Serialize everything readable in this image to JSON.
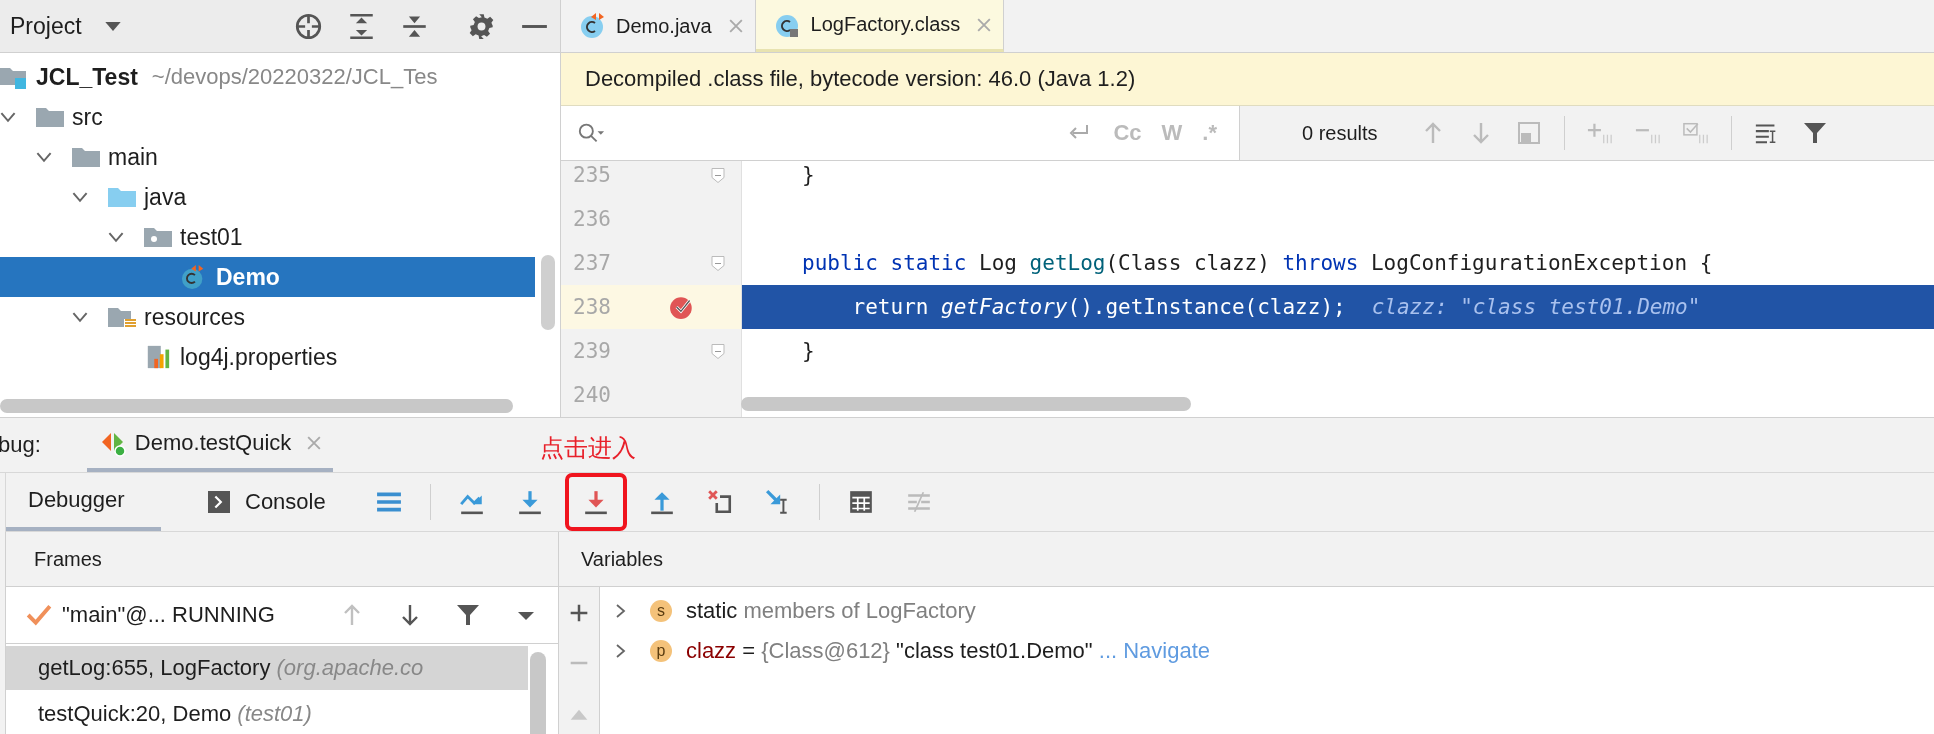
{
  "project_panel": {
    "title": "Project",
    "tools": [
      {
        "kind": "locate"
      },
      {
        "kind": "expand"
      },
      {
        "kind": "collapse"
      },
      {
        "kind": "gear"
      },
      {
        "kind": "hide"
      }
    ],
    "root": {
      "label": "JCL_Test",
      "path": "~/devops/20220322/JCL_Tes"
    },
    "tree": [
      {
        "label": "src",
        "kind": "folder",
        "expanded": true,
        "selected": false,
        "children": [
          {
            "label": "main",
            "kind": "folder",
            "expanded": true,
            "selected": false,
            "children": [
              {
                "label": "java",
                "kind": "source-folder",
                "expanded": true,
                "selected": false,
                "children": [
                  {
                    "label": "test01",
                    "kind": "package",
                    "expanded": true,
                    "selected": false,
                    "children": [
                      {
                        "label": "Demo",
                        "kind": "class",
                        "selected": true
                      }
                    ]
                  }
                ]
              },
              {
                "label": "resources",
                "kind": "resource-folder",
                "expanded": true,
                "selected": false,
                "children": [
                  {
                    "label": "log4j.properties",
                    "kind": "properties",
                    "selected": false
                  }
                ]
              }
            ]
          }
        ]
      }
    ]
  },
  "editor": {
    "tabs": [
      {
        "label": "Demo.java",
        "kind": "class",
        "selected": false
      },
      {
        "label": "LogFactory.class",
        "kind": "class-file",
        "selected": true
      }
    ],
    "banner": "Decompiled .class file, bytecode version: 46.0 (Java 1.2)",
    "search": {
      "tools": [
        {
          "kind": "wrap"
        },
        {
          "kind": "text",
          "text": "Cc"
        },
        {
          "kind": "text",
          "text": "W"
        },
        {
          "kind": "text",
          "text": ".*"
        }
      ],
      "results": "0 results",
      "actions": [
        {
          "kind": "up"
        },
        {
          "kind": "down"
        },
        {
          "kind": "box"
        },
        {
          "kind": "sep"
        },
        {
          "kind": "add"
        },
        {
          "kind": "remove"
        },
        {
          "kind": "check"
        },
        {
          "kind": "sep"
        },
        {
          "kind": "lines"
        },
        {
          "kind": "filter"
        }
      ]
    },
    "lines": [
      {
        "number": "235",
        "fold": true,
        "breakpoint": false,
        "current": false,
        "tokens": [
          {
            "kind": "plain",
            "text": "}"
          }
        ]
      },
      {
        "number": "236",
        "fold": false,
        "breakpoint": false,
        "current": false
      },
      {
        "number": "237",
        "fold": true,
        "breakpoint": false,
        "current": false,
        "tokens": [
          {
            "kind": "keyword",
            "text": "public static"
          },
          {
            "kind": "plain",
            "text": " Log "
          },
          {
            "kind": "method",
            "text": "getLog"
          },
          {
            "kind": "plain",
            "text": "(Class clazz) "
          },
          {
            "kind": "keyword",
            "text": "throws"
          },
          {
            "kind": "plain",
            "text": " LogConfigurationException {"
          }
        ]
      },
      {
        "number": "238",
        "fold": false,
        "breakpoint": true,
        "current": true,
        "tokens": [
          {
            "kind": "plain",
            "text": "    return "
          },
          {
            "kind": "static-call",
            "text": "getFactory"
          },
          {
            "kind": "plain",
            "text": "().getInstance(clazz);"
          },
          {
            "kind": "hint",
            "text": "clazz: \"class test01.Demo\""
          }
        ]
      },
      {
        "number": "239",
        "fold": true,
        "breakpoint": false,
        "current": false,
        "tokens": [
          {
            "kind": "plain",
            "text": "}"
          }
        ]
      },
      {
        "number": "240",
        "fold": false,
        "breakpoint": false,
        "current": false
      }
    ]
  },
  "debug": {
    "label": "bug:",
    "session_tab": {
      "label": "Demo.testQuick",
      "selected": true
    },
    "tabs": [
      {
        "label": "Debugger",
        "kind": "debugger",
        "selected": true
      },
      {
        "label": "Console",
        "kind": "console",
        "selected": false
      }
    ],
    "toolbar": [
      {
        "kind": "threads",
        "highlighted": false
      },
      {
        "kind": "sep"
      },
      {
        "kind": "step-over",
        "highlighted": false
      },
      {
        "kind": "step-into",
        "highlighted": false
      },
      {
        "kind": "force-step-into",
        "highlighted": true
      },
      {
        "kind": "step-out",
        "highlighted": false
      },
      {
        "kind": "drop-frame",
        "highlighted": false
      },
      {
        "kind": "run-to-cursor",
        "highlighted": false
      },
      {
        "kind": "sep"
      },
      {
        "kind": "evaluate",
        "highlighted": false
      },
      {
        "kind": "trace",
        "highlighted": false
      }
    ],
    "annotation": "点击进入",
    "frames": {
      "title": "Frames",
      "thread": "\"main\"@... RUNNING",
      "items": [
        {
          "method": "getLog:655, LogFactory",
          "package": "(org.apache.co",
          "selected": true
        },
        {
          "method": "testQuick:20, Demo",
          "package": "(test01)",
          "selected": false
        }
      ]
    },
    "variables": {
      "title": "Variables",
      "items": [
        {
          "badge": "s",
          "tokens": [
            {
              "kind": "plain",
              "text": "static"
            },
            {
              "kind": "grey",
              "text": " members of LogFactory"
            }
          ]
        },
        {
          "badge": "p",
          "tokens": [
            {
              "kind": "name",
              "text": "clazz"
            },
            {
              "kind": "plain",
              "text": " = "
            },
            {
              "kind": "grey",
              "text": "{Class@612}"
            },
            {
              "kind": "plain",
              "text": " \"class test01.Demo\" "
            },
            {
              "kind": "link",
              "text": "... Navigate"
            }
          ]
        }
      ]
    }
  }
}
